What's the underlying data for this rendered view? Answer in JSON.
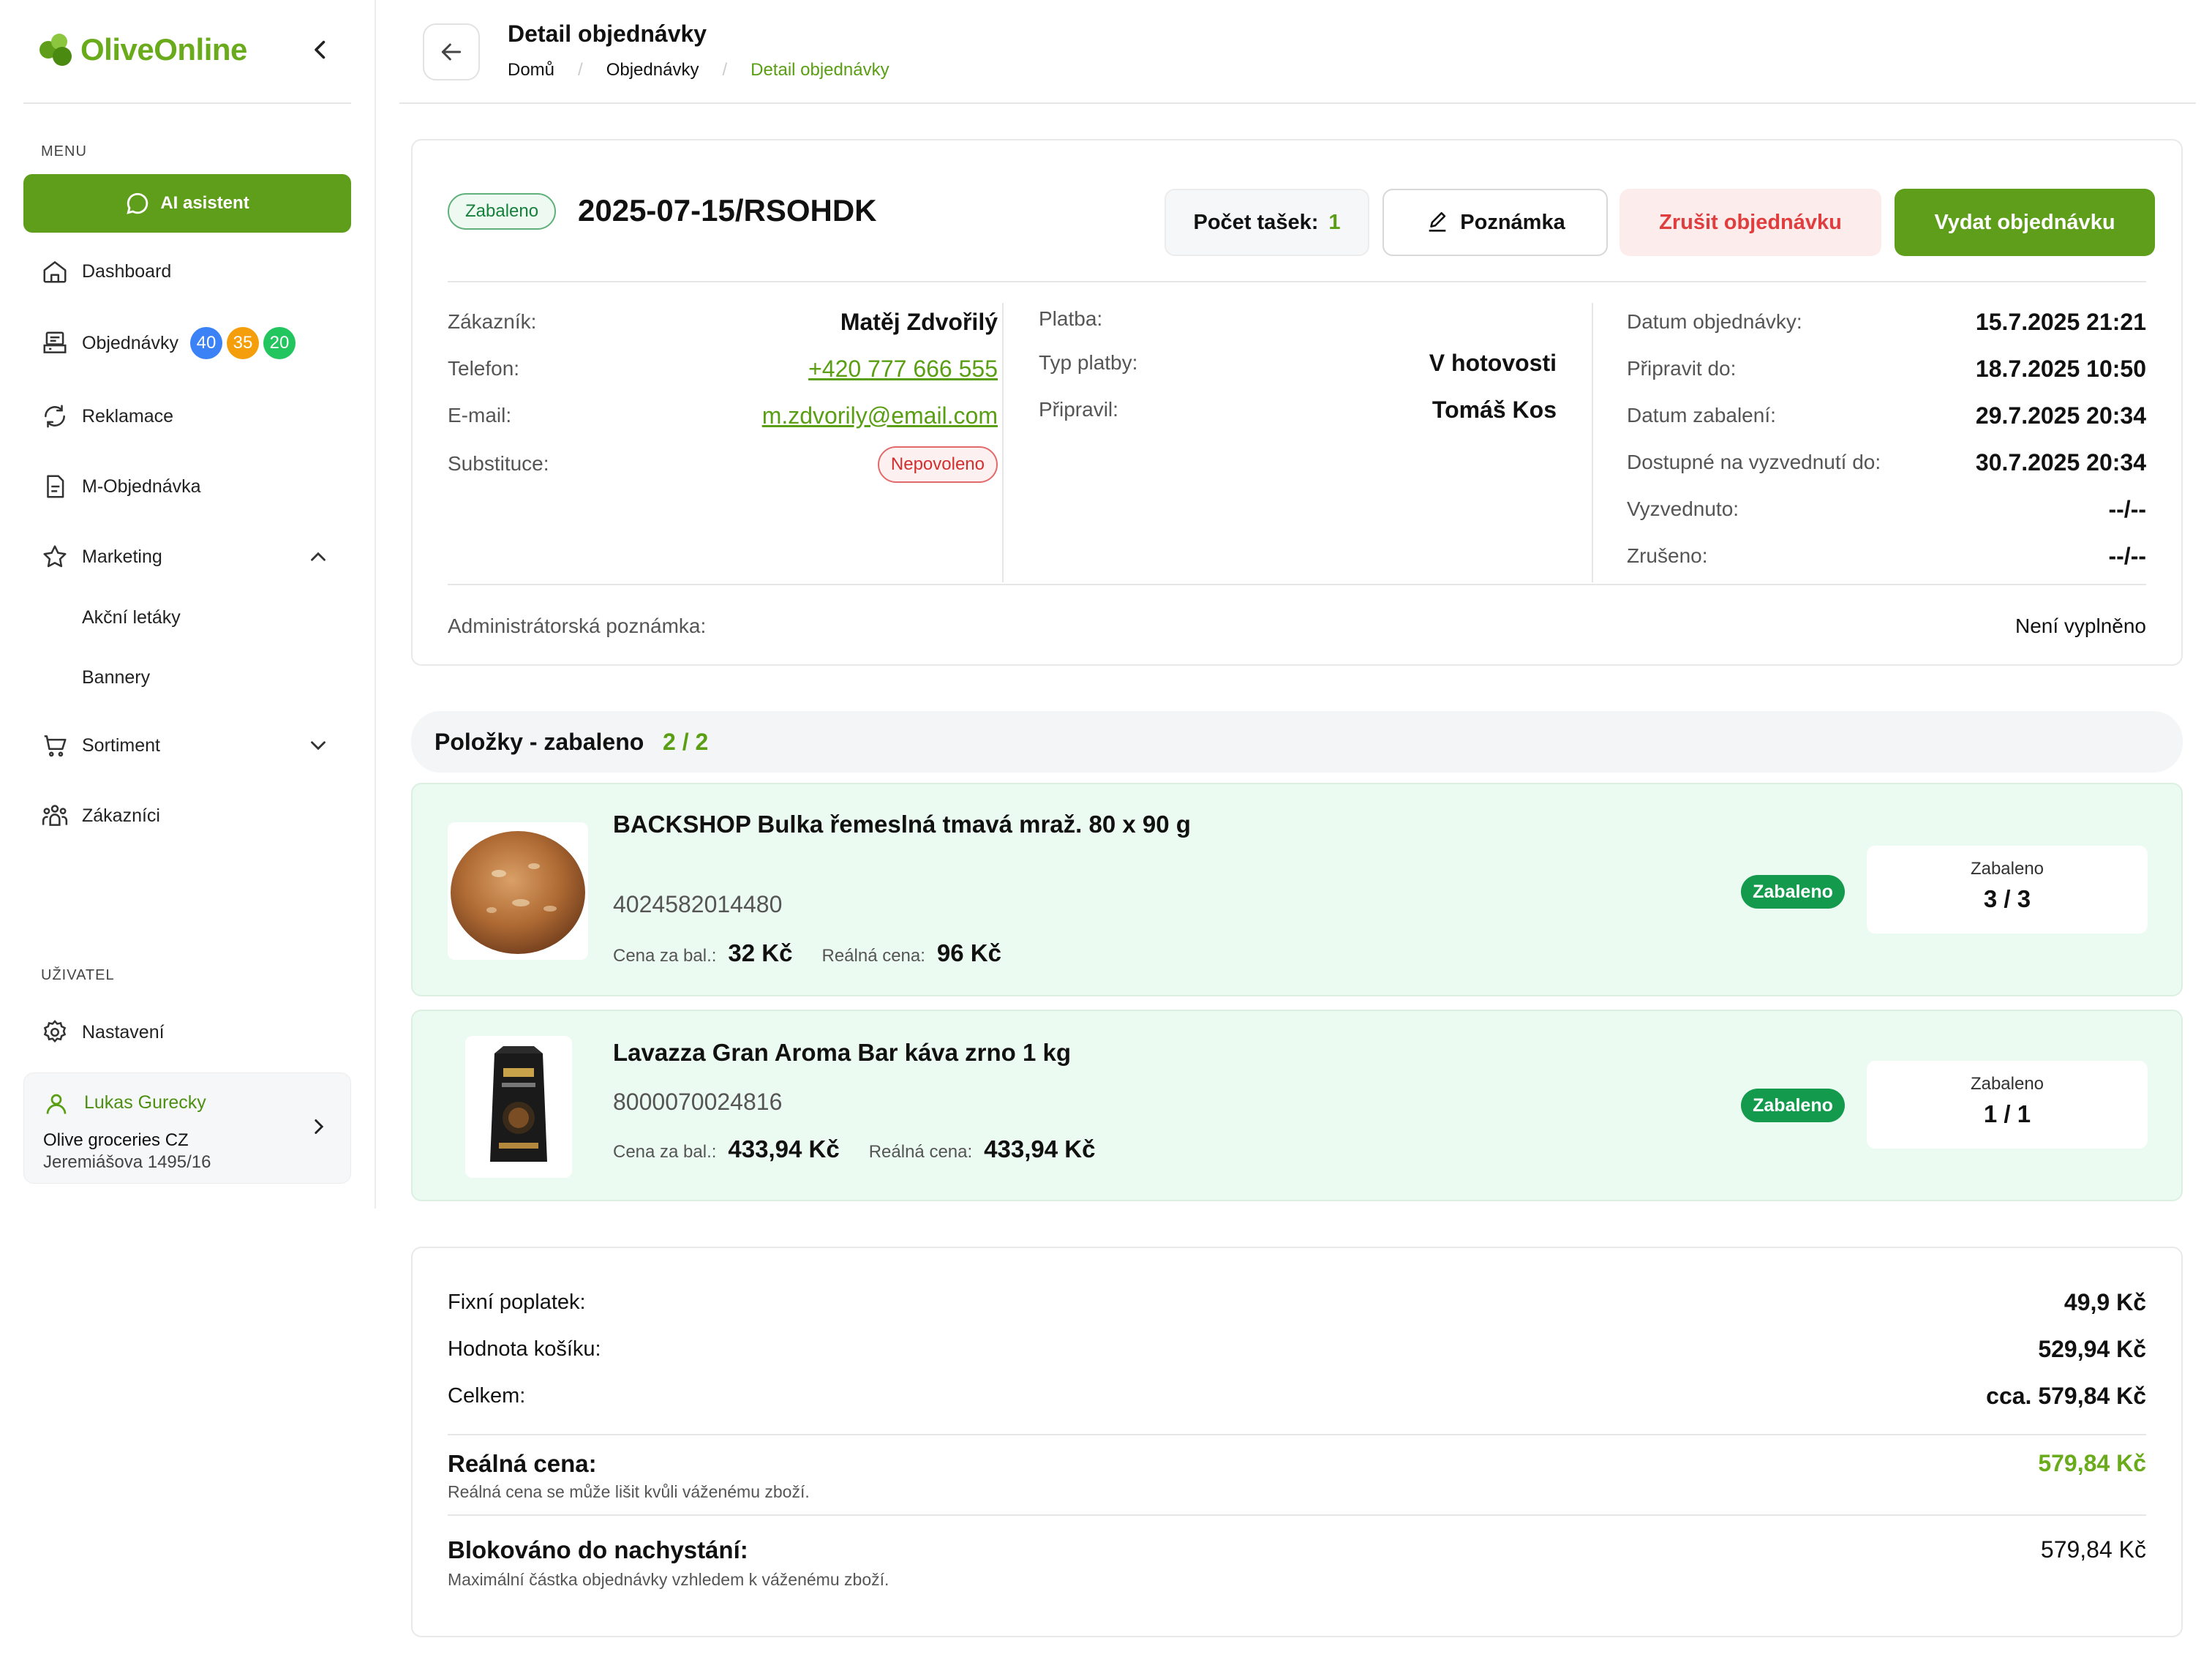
{
  "app": {
    "name": "OliveOnline"
  },
  "sidebar": {
    "menu_label": "MENU",
    "ai_button": "AI asistent",
    "items": [
      {
        "label": "Dashboard"
      },
      {
        "label": "Objednávky",
        "badges": [
          "40",
          "35",
          "20"
        ]
      },
      {
        "label": "Reklamace"
      },
      {
        "label": "M-Objednávka"
      },
      {
        "label": "Marketing",
        "subitems": [
          "Akční letáky",
          "Bannery"
        ]
      },
      {
        "label": "Sortiment"
      },
      {
        "label": "Zákazníci"
      }
    ],
    "user_section_label": "UŽIVATEL",
    "settings_label": "Nastavení",
    "user": {
      "name": "Lukas Gurecky",
      "company": "Olive groceries CZ",
      "address": "Jeremiášova 1495/16"
    }
  },
  "header": {
    "title": "Detail objednávky",
    "breadcrumb": [
      "Domů",
      "Objednávky",
      "Detail objednávky"
    ]
  },
  "order": {
    "status": "Zabaleno",
    "number": "2025-07-15/RSOHDK",
    "bags_label": "Počet tašek:",
    "bags_value": "1",
    "note_button": "Poznámka",
    "cancel_button": "Zrušit objednávku",
    "issue_button": "Vydat objednávku",
    "customer": {
      "customer_label": "Zákazník:",
      "customer_value": "Matěj Zdvořilý",
      "phone_label": "Telefon:",
      "phone_value": "+420 777 666 555",
      "email_label": "E-mail:",
      "email_value": "m.zdvorily@email.com",
      "subst_label": "Substituce:",
      "subst_value": "Nepovoleno"
    },
    "payment": {
      "payment_label": "Platba:",
      "type_label": "Typ platby:",
      "type_value": "V hotovosti",
      "prepared_label": "Připravil:",
      "prepared_value": "Tomáš Kos"
    },
    "dates": [
      {
        "label": "Datum objednávky:",
        "value": "15.7.2025 21:21"
      },
      {
        "label": "Připravit do:",
        "value": "18.7.2025 10:50"
      },
      {
        "label": "Datum zabalení:",
        "value": "29.7.2025 20:34"
      },
      {
        "label": "Dostupné na vyzvednutí do:",
        "value": "30.7.2025 20:34"
      },
      {
        "label": "Vyzvednuto:",
        "value": "--/--"
      },
      {
        "label": "Zrušeno:",
        "value": "--/--"
      }
    ],
    "admin_note_label": "Administrátorská poznámka:",
    "admin_note_value": "Není vyplněno"
  },
  "items_section": {
    "title": "Položky - zabaleno",
    "count": "2 / 2",
    "items": [
      {
        "name": "BACKSHOP Bulka řemeslná tmavá mraž. 80 x 90 g",
        "ean": "4024582014480",
        "unit_price_label": "Cena za bal.:",
        "unit_price": "32 Kč",
        "real_price_label": "Reálná cena:",
        "real_price": "96 Kč",
        "status": "Zabaleno",
        "packed_label": "Zabaleno",
        "packed_value": "3 / 3"
      },
      {
        "name": "Lavazza Gran Aroma Bar káva zrno 1 kg",
        "ean": "8000070024816",
        "unit_price_label": "Cena za bal.:",
        "unit_price": "433,94 Kč",
        "real_price_label": "Reálná cena:",
        "real_price": "433,94 Kč",
        "status": "Zabaleno",
        "packed_label": "Zabaleno",
        "packed_value": "1 / 1"
      }
    ]
  },
  "summary": {
    "fixed_fee_label": "Fixní poplatek:",
    "fixed_fee_value": "49,9 Kč",
    "basket_label": "Hodnota košíku:",
    "basket_value": "529,94 Kč",
    "total_label": "Celkem:",
    "total_value": "cca. 579,84 Kč",
    "real_label": "Reálná cena:",
    "real_value": "579,84 Kč",
    "real_note": "Reálná cena se může lišit kvůli váženému zboží.",
    "blocked_label": "Blokováno do nachystání:",
    "blocked_value": "579,84 Kč",
    "blocked_note": "Maximální částka objednávky vzhledem k váženému zboží."
  },
  "colors": {
    "brand_green": "#5f9e1a",
    "badge_blue": "#3b82f6",
    "badge_orange": "#f59e0b",
    "badge_green": "#22c55e",
    "danger": "#e03e3e",
    "status_green": "#139a4c"
  }
}
